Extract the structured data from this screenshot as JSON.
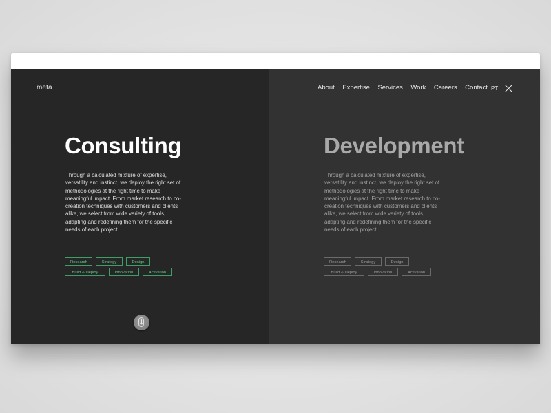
{
  "site": {
    "logo": "meta"
  },
  "nav": {
    "items": [
      {
        "label": "About"
      },
      {
        "label": "Expertise"
      },
      {
        "label": "Services"
      },
      {
        "label": "Work"
      },
      {
        "label": "Careers"
      },
      {
        "label": "Contact"
      }
    ],
    "language": "PT",
    "close_icon": "close-icon"
  },
  "panels": {
    "left": {
      "title": "Consulting",
      "description": "Through a calculated mixture of expertise, versatility and instinct, we deploy the right set of methodologies at the right time to make meaningful impact. From market research to co-creation techniques with customers and clients alike, we select from wide variety of tools, adapting and redefining them for the specific needs of each project.",
      "tags": [
        "Research",
        "Strategy",
        "Design",
        "Build & Deploy",
        "Innovation",
        "Activation"
      ],
      "accent_color": "#3e9e68",
      "state": "active"
    },
    "right": {
      "title": "Development",
      "description": "Through a calculated mixture of expertise, versatility and instinct, we deploy the right set of methodologies at the right time to make meaningful impact. From market research to co-creation techniques with customers and clients alike, we select from wide variety of tools, adapting and redefining them for the specific needs of each project.",
      "tags": [
        "Research",
        "Strategy",
        "Design",
        "Build & Deploy",
        "Innovation",
        "Activation"
      ],
      "accent_color": "#6a6a6a",
      "state": "inactive"
    }
  },
  "scroll_button": {
    "icon": "scroll-down-icon"
  }
}
